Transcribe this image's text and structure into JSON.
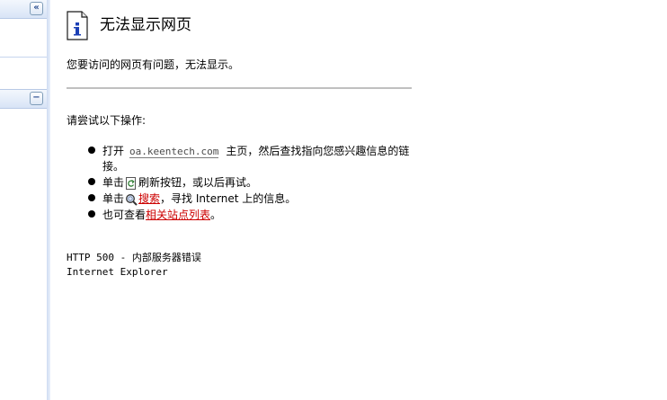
{
  "sidebar": {
    "top_button": "«",
    "mid_button": "−"
  },
  "page": {
    "title": "无法显示网页",
    "intro": "您要访问的网页有问题，无法显示。",
    "try_label": "请尝试以下操作:",
    "item1_prefix": "打开",
    "item1_url": "oa.keentech.com",
    "item1_suffix": "主页，然后查找指向您感兴趣信息的链接。",
    "item2_prefix": "单击",
    "item2_suffix": "刷新按钮，或以后再试。",
    "item3_prefix": "单击",
    "item3_link": "搜索",
    "item3_suffix": "，寻找 Internet 上的信息。",
    "item4_prefix": "也可查看",
    "item4_link": "相关站点列表",
    "item4_suffix": "。",
    "error_code": "HTTP 500 - 内部服务器错误",
    "browser": "Internet Explorer"
  },
  "icons": {
    "page_icon": "info-page-icon",
    "refresh_icon": "refresh-icon",
    "search_icon": "search-icon"
  },
  "colors": {
    "link": "#cc0000",
    "sidebar_accent": "#d8e4f6"
  }
}
